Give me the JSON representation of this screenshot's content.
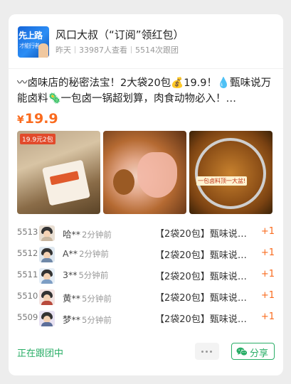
{
  "group": {
    "avatar_text_top": "先上路",
    "avatar_text_bottom": "才能行者",
    "title": "风口大叔（“订阅”领红包）",
    "time": "昨天",
    "views": "33987人查看",
    "followers": "5514次跟团"
  },
  "post": {
    "description": "〰卤味店的秘密法宝！2大袋20包💰19.9！💧甄味说万能卤料🦠一包卤一锅超划算，肉食动物必入！…",
    "currency": "¥",
    "price": "19.9",
    "photos": [
      {
        "badge": "19.9元2包"
      },
      {
        "badge": ""
      },
      {
        "badge": "一包卤料顶一大盆!"
      }
    ]
  },
  "orders": [
    {
      "num": "5513",
      "name": "哈**",
      "time": "2分钟前",
      "product": "【2袋20包】甄味说万能卤料",
      "qty": "+1"
    },
    {
      "num": "5512",
      "name": "A**",
      "time": "2分钟前",
      "product": "【2袋20包】甄味说万能卤料",
      "qty": "+1"
    },
    {
      "num": "5511",
      "name": "3**",
      "time": "5分钟前",
      "product": "【2袋20包】甄味说万能卤料",
      "qty": "+1"
    },
    {
      "num": "5510",
      "name": "黄**",
      "time": "5分钟前",
      "product": "【2袋20包】甄味说万能卤料",
      "qty": "+1"
    },
    {
      "num": "5509",
      "name": "梦**",
      "time": "5分钟前",
      "product": "【2袋20包】甄味说万能卤料",
      "qty": "+1"
    }
  ],
  "footer": {
    "status": "正在跟团中",
    "share_label": "分享"
  },
  "colors": {
    "accent_orange": "#fa6b1e",
    "brand_green": "#2aae67"
  },
  "icons": {
    "more": "more-dots-icon",
    "share": "wechat-icon"
  }
}
